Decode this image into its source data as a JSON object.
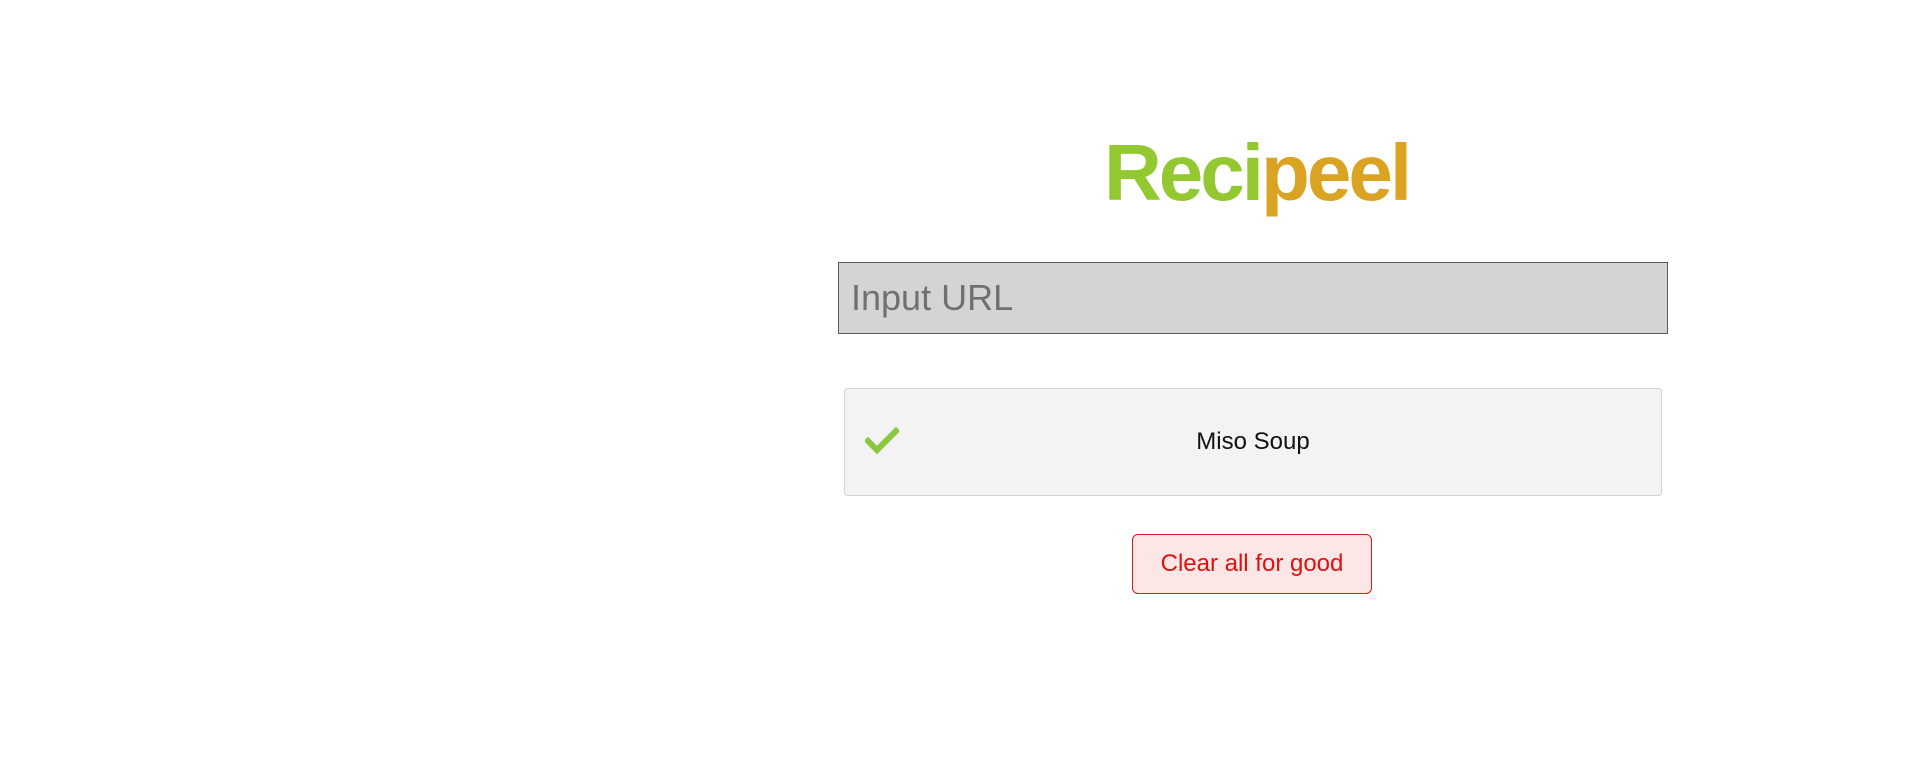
{
  "app": {
    "logo": {
      "part_a": "Reci",
      "part_b": "peel",
      "color_a": "#94c830",
      "color_b": "#dba322"
    }
  },
  "url_input": {
    "value": "",
    "placeholder": "Input URL"
  },
  "recipes": [
    {
      "name": "Miso Soup",
      "status_icon": "check-icon",
      "status_color": "#8cc63f"
    }
  ],
  "clear_button": {
    "label": "Clear all for good",
    "color": "#e01010"
  }
}
